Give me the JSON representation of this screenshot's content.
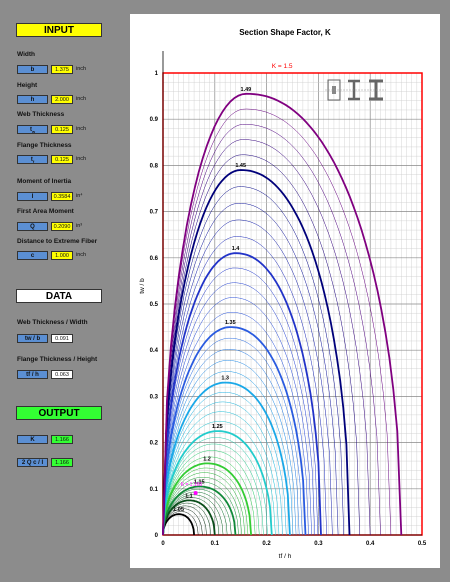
{
  "input": {
    "header": "INPUT",
    "width": {
      "label": "Width",
      "symbol": "b",
      "value": "1.375",
      "unit": "inch"
    },
    "height": {
      "label": "Height",
      "symbol": "h",
      "value": "2.000",
      "unit": "inch"
    },
    "web_thickness": {
      "label": "Web Thickness",
      "symbol": "t",
      "symbol_sub": "w",
      "value": "0.125",
      "unit": "inch"
    },
    "flange_thickness": {
      "label": "Flange Thickness",
      "symbol": "t",
      "symbol_sub": "f",
      "value": "0.125",
      "unit": "inch"
    },
    "moment_of_inertia": {
      "label": "Moment of Inertia",
      "symbol": "I",
      "value": "0.3584",
      "unit": "in⁴"
    },
    "first_area_moment": {
      "label": "First Area Moment",
      "symbol": "Q",
      "value": "0.2090",
      "unit": "in³"
    },
    "distance_extreme": {
      "label": "Distance to Extreme Fiber",
      "symbol": "c",
      "value": "1.000",
      "unit": "inch"
    }
  },
  "data": {
    "header": "DATA",
    "web_width": {
      "label": "Web Thickness / Width",
      "symbol": "tw / b",
      "value": "0.091"
    },
    "flange_height": {
      "label": "Flange Thickness / Height",
      "symbol": "tf / h",
      "value": "0.063"
    }
  },
  "output": {
    "header": "OUTPUT",
    "k": {
      "symbol": "K",
      "value": "1.166"
    },
    "k2": {
      "symbol": "2 Q c / I",
      "value": "1.166"
    }
  },
  "chart_data": {
    "type": "line",
    "title": "Section Shape Factor, K",
    "xlabel": "tf / h",
    "ylabel": "tw / b",
    "xlim": [
      0,
      0.5
    ],
    "ylim": [
      0,
      1
    ],
    "x_ticks": [
      "0",
      "0.1",
      "0.2",
      "0.3",
      "0.4",
      "0.5"
    ],
    "y_ticks": [
      "0",
      "0.1",
      "0.2",
      "0.3",
      "0.4",
      "0.5",
      "0.6",
      "0.7",
      "0.8",
      "0.9",
      "1"
    ],
    "boundary_label": "K = 1.5",
    "marker_label": "K = 1.166",
    "marker": {
      "x": 0.063,
      "y": 0.091
    },
    "labeled_contours": [
      {
        "k": "1.05",
        "x_end": 0.06,
        "peak_x": 0.03,
        "peak": 0.045,
        "color": "#000000"
      },
      {
        "k": "1.1",
        "x_end": 0.1,
        "peak_x": 0.05,
        "peak": 0.075,
        "color": "#0a4d1a"
      },
      {
        "k": "1.15",
        "x_end": 0.14,
        "peak_x": 0.07,
        "peak": 0.105,
        "color": "#118a3a"
      },
      {
        "k": "1.2",
        "x_end": 0.17,
        "peak_x": 0.085,
        "peak": 0.155,
        "color": "#33cc33"
      },
      {
        "k": "1.25",
        "x_end": 0.21,
        "peak_x": 0.105,
        "peak": 0.225,
        "color": "#22cccc"
      },
      {
        "k": "1.3",
        "x_end": 0.245,
        "peak_x": 0.12,
        "peak": 0.33,
        "color": "#1aa8e8"
      },
      {
        "k": "1.35",
        "x_end": 0.275,
        "peak_x": 0.13,
        "peak": 0.45,
        "color": "#2a5be0"
      },
      {
        "k": "1.4",
        "x_end": 0.305,
        "peak_x": 0.14,
        "peak": 0.61,
        "color": "#2233c8"
      },
      {
        "k": "1.45",
        "x_end": 0.36,
        "peak_x": 0.15,
        "peak": 0.79,
        "color": "#00007a"
      },
      {
        "k": "1.49",
        "x_end": 0.46,
        "peak_x": 0.16,
        "peak": 0.955,
        "color": "#800080"
      }
    ]
  }
}
